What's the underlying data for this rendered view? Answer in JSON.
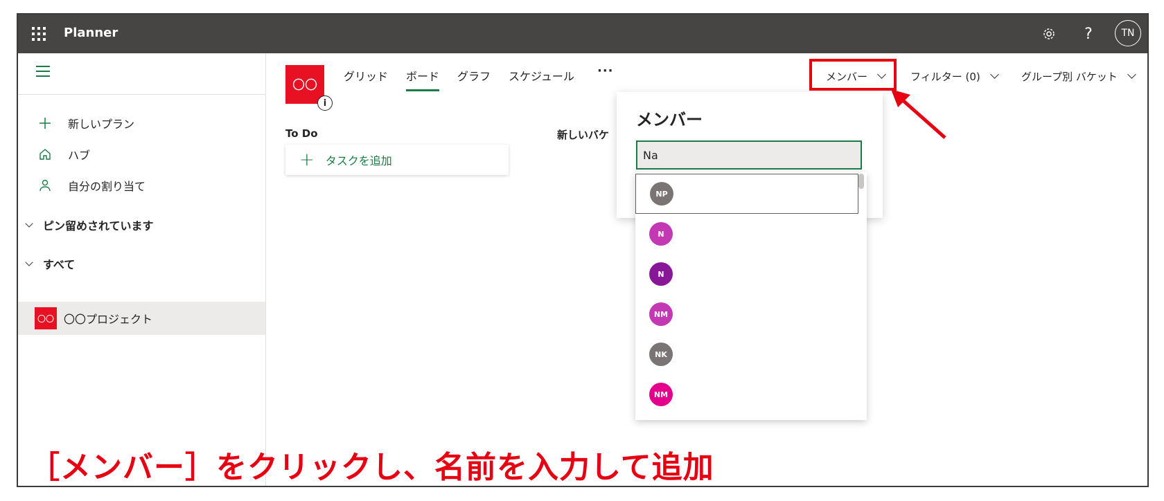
{
  "app": {
    "title": "Planner"
  },
  "topbar": {
    "avatar_initials": "TN",
    "help_glyph": "?"
  },
  "sidebar": {
    "items": [
      {
        "label": "新しいプラン",
        "icon": "plus-icon"
      },
      {
        "label": "ハブ",
        "icon": "home-icon"
      },
      {
        "label": "自分の割り当て",
        "icon": "person-icon"
      }
    ],
    "sections": [
      {
        "label": "ピン留めされています"
      },
      {
        "label": "すべて"
      }
    ],
    "plan": {
      "logo": "〇〇",
      "name": "〇〇プロジェクト"
    }
  },
  "plan_header": {
    "badge": "〇〇",
    "info_glyph": "i",
    "tabs": [
      {
        "label": "グリッド"
      },
      {
        "label": "ボード",
        "active": true
      },
      {
        "label": "グラフ"
      },
      {
        "label": "スケジュール"
      }
    ],
    "more_glyph": "···",
    "toolbar": {
      "members": "メンバー",
      "filter": "フィルター (0)",
      "group": "グループ別 バケット"
    }
  },
  "board": {
    "buckets": [
      {
        "title": "To Do"
      },
      {
        "title": "新しいバケ"
      }
    ],
    "add_task": {
      "plus": "+",
      "label": "タスクを追加"
    }
  },
  "member_panel": {
    "title": "メンバー",
    "search_value": "Na",
    "suggestions": [
      {
        "initials": "NP",
        "color": "#7a7574"
      },
      {
        "initials": "N",
        "color": "#c239b3"
      },
      {
        "initials": "N",
        "color": "#881798"
      },
      {
        "initials": "NM",
        "color": "#c239b3"
      },
      {
        "initials": "NK",
        "color": "#7a7574"
      },
      {
        "initials": "NM",
        "color": "#e3008c"
      }
    ]
  },
  "annotation": {
    "caption": "［メンバー］をクリックし、名前を入力して追加",
    "highlight_color": "#e60012"
  },
  "colors": {
    "accent": "#1a7b45",
    "topbar": "#474543",
    "plan_red": "#e81123"
  }
}
